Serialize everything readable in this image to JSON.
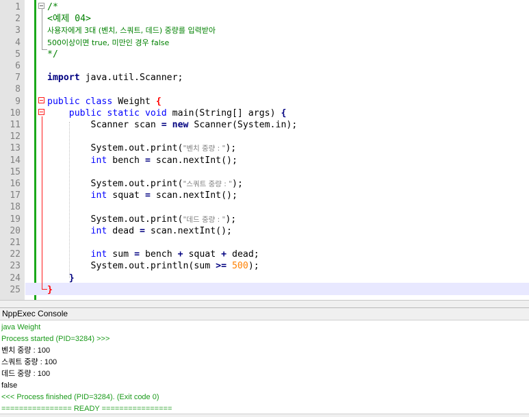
{
  "editor": {
    "lines": [
      {
        "n": "1",
        "parts": [
          {
            "t": "/*",
            "c": "cm"
          }
        ]
      },
      {
        "n": "2",
        "parts": [
          {
            "t": "<예제 04>",
            "c": "cm"
          }
        ]
      },
      {
        "n": "3",
        "parts": [
          {
            "t": "사용자에게 3대 (벤치, 스쿼트, 데드) 중량를 입력받아",
            "c": "cmk"
          }
        ]
      },
      {
        "n": "4",
        "parts": [
          {
            "t": "500이상이면 true, 미만인 경우 false",
            "c": "cmk"
          }
        ]
      },
      {
        "n": "5",
        "parts": [
          {
            "t": "*/",
            "c": "cm"
          }
        ]
      },
      {
        "n": "6",
        "parts": []
      },
      {
        "n": "7",
        "parts": [
          {
            "t": "import",
            "c": "kwb"
          },
          {
            "t": " java.util.Scanner;",
            "c": ""
          }
        ]
      },
      {
        "n": "8",
        "parts": []
      },
      {
        "n": "9",
        "parts": [
          {
            "t": "public",
            "c": "kw"
          },
          {
            "t": " ",
            "c": ""
          },
          {
            "t": "class",
            "c": "kw"
          },
          {
            "t": " Weight ",
            "c": ""
          },
          {
            "t": "{",
            "c": "br"
          }
        ]
      },
      {
        "n": "10",
        "parts": [
          {
            "t": "    ",
            "c": ""
          },
          {
            "t": "public",
            "c": "kw"
          },
          {
            "t": " ",
            "c": ""
          },
          {
            "t": "static",
            "c": "kw"
          },
          {
            "t": " ",
            "c": ""
          },
          {
            "t": "void",
            "c": "kw"
          },
          {
            "t": " main(String[] args) ",
            "c": ""
          },
          {
            "t": "{",
            "c": "op"
          }
        ]
      },
      {
        "n": "11",
        "parts": [
          {
            "t": "        Scanner scan ",
            "c": ""
          },
          {
            "t": "=",
            "c": "op"
          },
          {
            "t": " ",
            "c": ""
          },
          {
            "t": "new",
            "c": "kwb"
          },
          {
            "t": " Scanner(System.in);",
            "c": ""
          }
        ]
      },
      {
        "n": "12",
        "parts": []
      },
      {
        "n": "13",
        "parts": [
          {
            "t": "        System.out.print(",
            "c": ""
          },
          {
            "t": "\"벤치 중량 : \"",
            "c": "str"
          },
          {
            "t": ");",
            "c": ""
          }
        ]
      },
      {
        "n": "14",
        "parts": [
          {
            "t": "        ",
            "c": ""
          },
          {
            "t": "int",
            "c": "kw"
          },
          {
            "t": " bench ",
            "c": ""
          },
          {
            "t": "=",
            "c": "op"
          },
          {
            "t": " scan.nextInt();",
            "c": ""
          }
        ]
      },
      {
        "n": "15",
        "parts": []
      },
      {
        "n": "16",
        "parts": [
          {
            "t": "        System.out.print(",
            "c": ""
          },
          {
            "t": "\"스쿼트 중량 : \"",
            "c": "str"
          },
          {
            "t": ");",
            "c": ""
          }
        ]
      },
      {
        "n": "17",
        "parts": [
          {
            "t": "        ",
            "c": ""
          },
          {
            "t": "int",
            "c": "kw"
          },
          {
            "t": " squat ",
            "c": ""
          },
          {
            "t": "=",
            "c": "op"
          },
          {
            "t": " scan.nextInt();",
            "c": ""
          }
        ]
      },
      {
        "n": "18",
        "parts": []
      },
      {
        "n": "19",
        "parts": [
          {
            "t": "        System.out.print(",
            "c": ""
          },
          {
            "t": "\"데드 중량 : \"",
            "c": "str"
          },
          {
            "t": ");",
            "c": ""
          }
        ]
      },
      {
        "n": "20",
        "parts": [
          {
            "t": "        ",
            "c": ""
          },
          {
            "t": "int",
            "c": "kw"
          },
          {
            "t": " dead ",
            "c": ""
          },
          {
            "t": "=",
            "c": "op"
          },
          {
            "t": " scan.nextInt();",
            "c": ""
          }
        ]
      },
      {
        "n": "21",
        "parts": []
      },
      {
        "n": "22",
        "parts": [
          {
            "t": "        ",
            "c": ""
          },
          {
            "t": "int",
            "c": "kw"
          },
          {
            "t": " sum ",
            "c": ""
          },
          {
            "t": "=",
            "c": "op"
          },
          {
            "t": " bench ",
            "c": ""
          },
          {
            "t": "+",
            "c": "op"
          },
          {
            "t": " squat ",
            "c": ""
          },
          {
            "t": "+",
            "c": "op"
          },
          {
            "t": " dead;",
            "c": ""
          }
        ]
      },
      {
        "n": "23",
        "parts": [
          {
            "t": "        System.out.println(sum ",
            "c": ""
          },
          {
            "t": ">=",
            "c": "op"
          },
          {
            "t": " ",
            "c": ""
          },
          {
            "t": "500",
            "c": "num"
          },
          {
            "t": ");",
            "c": ""
          }
        ]
      },
      {
        "n": "24",
        "parts": [
          {
            "t": "    ",
            "c": ""
          },
          {
            "t": "}",
            "c": "op"
          }
        ]
      },
      {
        "n": "25",
        "parts": [
          {
            "t": "}",
            "c": "br"
          }
        ]
      }
    ]
  },
  "console": {
    "title": "NppExec Console",
    "lines": [
      {
        "t": "java Weight",
        "c": "g"
      },
      {
        "t": "Process started (PID=3284) >>>",
        "c": "g"
      },
      {
        "t": "벤치 중량 : 100",
        "c": "k"
      },
      {
        "t": "스쿼트 중량 : 100",
        "c": "k"
      },
      {
        "t": "데드 중량 : 100",
        "c": "k"
      },
      {
        "t": "false",
        "c": "k"
      },
      {
        "t": "<<< Process finished (PID=3284). (Exit code 0)",
        "c": "g"
      },
      {
        "t": "================ READY ================",
        "c": "g"
      }
    ]
  },
  "colors": {
    "comment": "#008000",
    "keyword": "#0000ff",
    "brace_match": "#ff0000",
    "number": "#ff8000",
    "string": "#808080",
    "console_text": "#1a9a1a",
    "current_line": "#e8e8ff"
  }
}
